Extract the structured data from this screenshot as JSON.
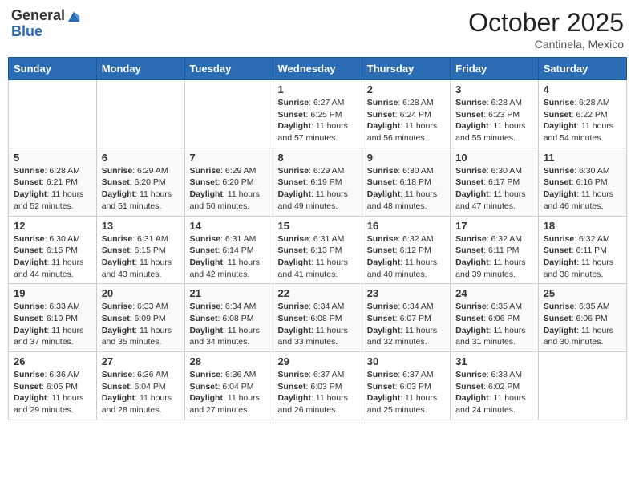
{
  "header": {
    "logo_general": "General",
    "logo_blue": "Blue",
    "month_title": "October 2025",
    "location": "Cantinela, Mexico"
  },
  "days_of_week": [
    "Sunday",
    "Monday",
    "Tuesday",
    "Wednesday",
    "Thursday",
    "Friday",
    "Saturday"
  ],
  "weeks": [
    [
      {
        "day": "",
        "info": ""
      },
      {
        "day": "",
        "info": ""
      },
      {
        "day": "",
        "info": ""
      },
      {
        "day": "1",
        "info": "Sunrise: 6:27 AM\nSunset: 6:25 PM\nDaylight: 11 hours and 57 minutes."
      },
      {
        "day": "2",
        "info": "Sunrise: 6:28 AM\nSunset: 6:24 PM\nDaylight: 11 hours and 56 minutes."
      },
      {
        "day": "3",
        "info": "Sunrise: 6:28 AM\nSunset: 6:23 PM\nDaylight: 11 hours and 55 minutes."
      },
      {
        "day": "4",
        "info": "Sunrise: 6:28 AM\nSunset: 6:22 PM\nDaylight: 11 hours and 54 minutes."
      }
    ],
    [
      {
        "day": "5",
        "info": "Sunrise: 6:28 AM\nSunset: 6:21 PM\nDaylight: 11 hours and 52 minutes."
      },
      {
        "day": "6",
        "info": "Sunrise: 6:29 AM\nSunset: 6:20 PM\nDaylight: 11 hours and 51 minutes."
      },
      {
        "day": "7",
        "info": "Sunrise: 6:29 AM\nSunset: 6:20 PM\nDaylight: 11 hours and 50 minutes."
      },
      {
        "day": "8",
        "info": "Sunrise: 6:29 AM\nSunset: 6:19 PM\nDaylight: 11 hours and 49 minutes."
      },
      {
        "day": "9",
        "info": "Sunrise: 6:30 AM\nSunset: 6:18 PM\nDaylight: 11 hours and 48 minutes."
      },
      {
        "day": "10",
        "info": "Sunrise: 6:30 AM\nSunset: 6:17 PM\nDaylight: 11 hours and 47 minutes."
      },
      {
        "day": "11",
        "info": "Sunrise: 6:30 AM\nSunset: 6:16 PM\nDaylight: 11 hours and 46 minutes."
      }
    ],
    [
      {
        "day": "12",
        "info": "Sunrise: 6:30 AM\nSunset: 6:15 PM\nDaylight: 11 hours and 44 minutes."
      },
      {
        "day": "13",
        "info": "Sunrise: 6:31 AM\nSunset: 6:15 PM\nDaylight: 11 hours and 43 minutes."
      },
      {
        "day": "14",
        "info": "Sunrise: 6:31 AM\nSunset: 6:14 PM\nDaylight: 11 hours and 42 minutes."
      },
      {
        "day": "15",
        "info": "Sunrise: 6:31 AM\nSunset: 6:13 PM\nDaylight: 11 hours and 41 minutes."
      },
      {
        "day": "16",
        "info": "Sunrise: 6:32 AM\nSunset: 6:12 PM\nDaylight: 11 hours and 40 minutes."
      },
      {
        "day": "17",
        "info": "Sunrise: 6:32 AM\nSunset: 6:11 PM\nDaylight: 11 hours and 39 minutes."
      },
      {
        "day": "18",
        "info": "Sunrise: 6:32 AM\nSunset: 6:11 PM\nDaylight: 11 hours and 38 minutes."
      }
    ],
    [
      {
        "day": "19",
        "info": "Sunrise: 6:33 AM\nSunset: 6:10 PM\nDaylight: 11 hours and 37 minutes."
      },
      {
        "day": "20",
        "info": "Sunrise: 6:33 AM\nSunset: 6:09 PM\nDaylight: 11 hours and 35 minutes."
      },
      {
        "day": "21",
        "info": "Sunrise: 6:34 AM\nSunset: 6:08 PM\nDaylight: 11 hours and 34 minutes."
      },
      {
        "day": "22",
        "info": "Sunrise: 6:34 AM\nSunset: 6:08 PM\nDaylight: 11 hours and 33 minutes."
      },
      {
        "day": "23",
        "info": "Sunrise: 6:34 AM\nSunset: 6:07 PM\nDaylight: 11 hours and 32 minutes."
      },
      {
        "day": "24",
        "info": "Sunrise: 6:35 AM\nSunset: 6:06 PM\nDaylight: 11 hours and 31 minutes."
      },
      {
        "day": "25",
        "info": "Sunrise: 6:35 AM\nSunset: 6:06 PM\nDaylight: 11 hours and 30 minutes."
      }
    ],
    [
      {
        "day": "26",
        "info": "Sunrise: 6:36 AM\nSunset: 6:05 PM\nDaylight: 11 hours and 29 minutes."
      },
      {
        "day": "27",
        "info": "Sunrise: 6:36 AM\nSunset: 6:04 PM\nDaylight: 11 hours and 28 minutes."
      },
      {
        "day": "28",
        "info": "Sunrise: 6:36 AM\nSunset: 6:04 PM\nDaylight: 11 hours and 27 minutes."
      },
      {
        "day": "29",
        "info": "Sunrise: 6:37 AM\nSunset: 6:03 PM\nDaylight: 11 hours and 26 minutes."
      },
      {
        "day": "30",
        "info": "Sunrise: 6:37 AM\nSunset: 6:03 PM\nDaylight: 11 hours and 25 minutes."
      },
      {
        "day": "31",
        "info": "Sunrise: 6:38 AM\nSunset: 6:02 PM\nDaylight: 11 hours and 24 minutes."
      },
      {
        "day": "",
        "info": ""
      }
    ]
  ]
}
